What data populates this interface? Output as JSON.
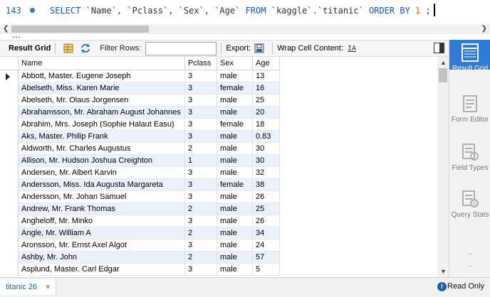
{
  "editor": {
    "line_number": "143",
    "sql_select": "SELECT",
    "sql_columns": "`Name`, `Pclass`, `Sex`, `Age`",
    "sql_from": "FROM",
    "sql_table": "`kaggle`.`titanic`",
    "sql_order": "ORDER BY",
    "sql_order_value": "1",
    "sql_end": ";"
  },
  "toolbar": {
    "result_grid": "Result Grid",
    "filter_rows": "Filter Rows:",
    "filter_value": "",
    "export": "Export:",
    "wrap_cell": "Wrap Cell Content:",
    "wrap_icon": "IA"
  },
  "grid": {
    "columns": [
      "Name",
      "Pclass",
      "Sex",
      "Age"
    ],
    "rows": [
      [
        "Abbott, Master. Eugene Joseph",
        "3",
        "male",
        "13"
      ],
      [
        "Abelseth, Miss. Karen Marie",
        "3",
        "female",
        "16"
      ],
      [
        "Abelseth, Mr. Olaus Jorgensen",
        "3",
        "male",
        "25"
      ],
      [
        "Abrahamsson, Mr. Abraham August Johannes",
        "3",
        "male",
        "20"
      ],
      [
        "Abrahim, Mrs. Joseph (Sophie Halaut Easu)",
        "3",
        "female",
        "18"
      ],
      [
        "Aks, Master. Philip Frank",
        "3",
        "male",
        "0.83"
      ],
      [
        "Aldworth, Mr. Charles Augustus",
        "2",
        "male",
        "30"
      ],
      [
        "Allison, Mr. Hudson Joshua Creighton",
        "1",
        "male",
        "30"
      ],
      [
        "Andersen, Mr. Albert Karvin",
        "3",
        "male",
        "32"
      ],
      [
        "Andersson, Miss. Ida Augusta Margareta",
        "3",
        "female",
        "38"
      ],
      [
        "Andersson, Mr. Johan Samuel",
        "3",
        "male",
        "26"
      ],
      [
        "Andrew, Mr. Frank Thomas",
        "2",
        "male",
        "25"
      ],
      [
        "Angheloff, Mr. Minko",
        "3",
        "male",
        "26"
      ],
      [
        "Angle, Mr. William A",
        "2",
        "male",
        "34"
      ],
      [
        "Aronsson, Mr. Ernst Axel Algot",
        "3",
        "male",
        "24"
      ],
      [
        "Ashby, Mr. John",
        "2",
        "male",
        "57"
      ],
      [
        "Asplund, Master. Carl Edgar",
        "3",
        "male",
        "5"
      ]
    ]
  },
  "side_panel": {
    "items": [
      {
        "label": "Result Grid",
        "active": true
      },
      {
        "label": "Form Editor",
        "active": false
      },
      {
        "label": "Field Types",
        "active": false
      },
      {
        "label": "Query Stats",
        "active": false
      }
    ]
  },
  "status": {
    "tab_label": "titanic 26",
    "tab_close": "×",
    "info": "i",
    "read_only": "Read Only"
  },
  "colors": {
    "accent": "#2f7bd9",
    "keyword": "#1a55c6",
    "row_stripe": "#eaf1fb"
  }
}
